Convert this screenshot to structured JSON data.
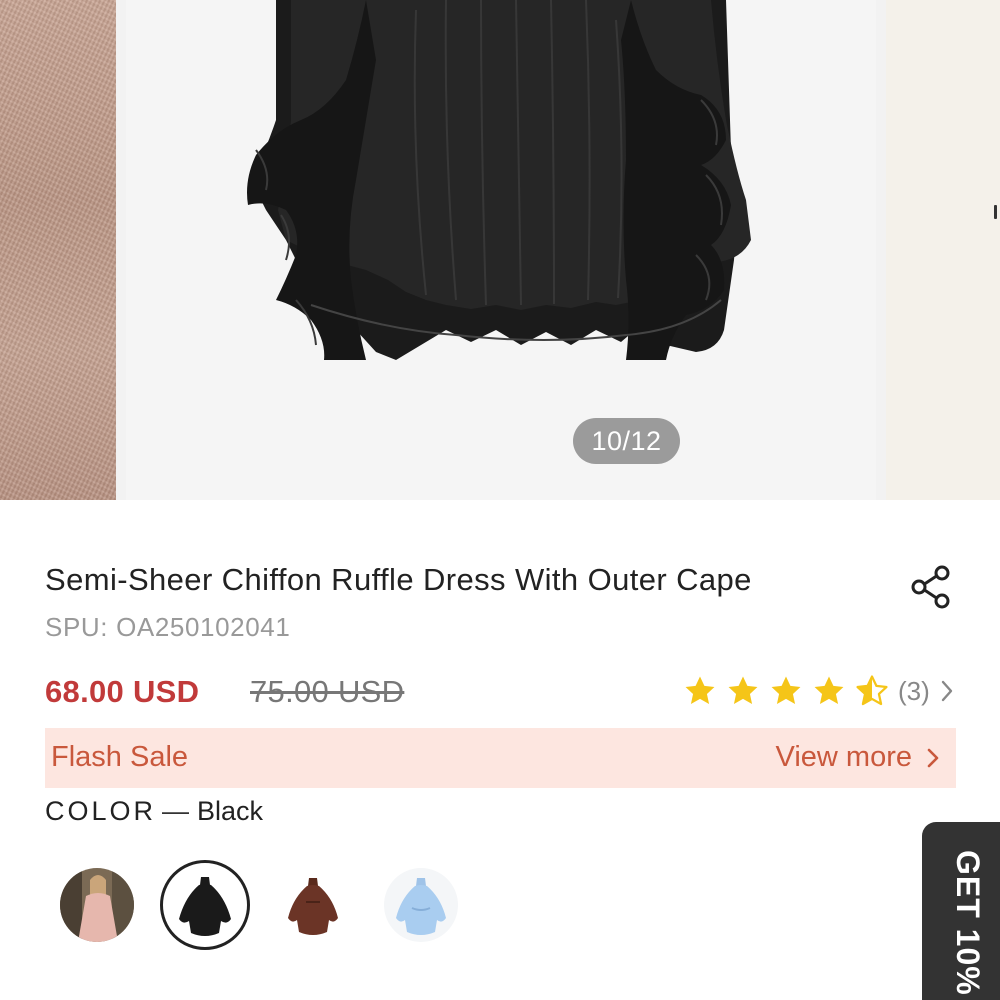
{
  "gallery": {
    "counter": "10/12",
    "current_index": 10,
    "total": 12
  },
  "product": {
    "title": "Semi-Sheer Chiffon Ruffle Dress With Outer Cape",
    "spu_label": "SPU:",
    "spu_value": "OA250102041",
    "price": "68.00 USD",
    "original_price": "75.00 USD",
    "rating": {
      "value": 4.5,
      "max": 5,
      "review_count": "(3)"
    }
  },
  "flash_sale": {
    "label": "Flash Sale",
    "link": "View more"
  },
  "color": {
    "label": "COLOR",
    "separator": "—",
    "selected": "Black",
    "options": [
      "model-photo",
      "black",
      "brown",
      "light-blue"
    ]
  },
  "promo_tab": {
    "text": "GET 10%"
  },
  "icons": {
    "share": "share-icon",
    "chevron": "chevron-right-icon",
    "star": "star-icon"
  },
  "colors": {
    "price_red": "#c13a3a",
    "flash_bg": "#fde6e0",
    "flash_text": "#c9583c",
    "star_yellow": "#f5c518",
    "promo_bg": "#333333"
  }
}
